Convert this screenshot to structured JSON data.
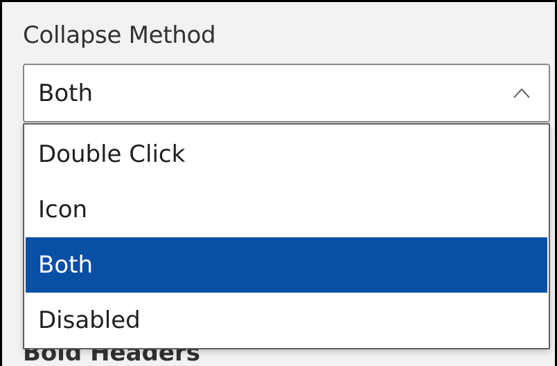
{
  "field": {
    "label": "Collapse Method",
    "selected_value": "Both"
  },
  "dropdown": {
    "options": [
      {
        "label": "Double Click",
        "selected": false
      },
      {
        "label": "Icon",
        "selected": false
      },
      {
        "label": "Both",
        "selected": true
      },
      {
        "label": "Disabled",
        "selected": false
      }
    ]
  },
  "next_field": {
    "label": "Bold Headers"
  },
  "colors": {
    "highlight": "#0a4fa6",
    "panel_bg": "#f3f2f1",
    "text": "#201f1e"
  },
  "icons": {
    "dropdown_toggle": "chevron-up-icon"
  }
}
